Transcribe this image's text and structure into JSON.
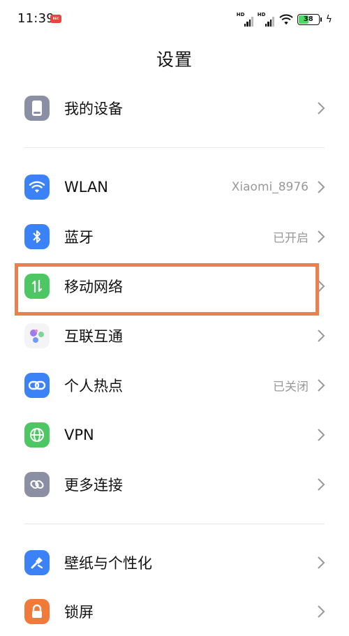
{
  "status_bar": {
    "time": "11:39",
    "rec_badge": "REC",
    "signal1_label": "HD",
    "signal2_label": "HD",
    "battery": "38"
  },
  "page_title": "设置",
  "sections": {
    "device": {
      "label": "我的设备",
      "icon": "phone-icon"
    },
    "wlan": {
      "label": "WLAN",
      "value": "Xiaomi_8976",
      "icon": "wifi-icon"
    },
    "bluetooth": {
      "label": "蓝牙",
      "value": "已开启",
      "icon": "bluetooth-icon"
    },
    "mobile": {
      "label": "移动网络",
      "icon": "mobile-data-icon"
    },
    "interconnect": {
      "label": "互联互通",
      "icon": "dots-icon"
    },
    "hotspot": {
      "label": "个人热点",
      "value": "已关闭",
      "icon": "hotspot-link-icon"
    },
    "vpn": {
      "label": "VPN",
      "icon": "globe-icon"
    },
    "more": {
      "label": "更多连接",
      "icon": "link-icon"
    },
    "wallpaper": {
      "label": "壁纸与个性化",
      "icon": "brush-icon"
    },
    "lockscreen": {
      "label": "锁屏",
      "icon": "lock-icon"
    }
  },
  "colors": {
    "highlight": "#e9804f",
    "blue": "#3b82f6",
    "green": "#4cc764",
    "gray": "#8a8fa3"
  }
}
